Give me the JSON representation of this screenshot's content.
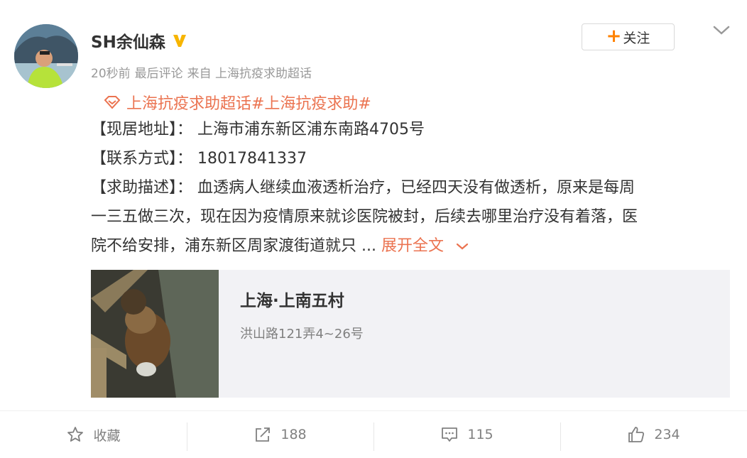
{
  "post": {
    "username": "SH余仙森",
    "meta_time": "20秒前",
    "meta_comment": "最后评论",
    "meta_source": "来自 上海抗疫求助超话",
    "follow_label": "关注",
    "topic": "上海抗疫求助超话#上海抗疫求助#",
    "line1": "【现居地址】： 上海市浦东新区浦东南路4705号",
    "line2": "【联系方式】： 18017841337",
    "line3": "【求助描述】： 血透病人继续血液透析治疗，已经四天没有做透析，原来是每周",
    "line4": "一三五做三次，现在因为疫情原来就诊医院被封，后续去哪里治疗没有着落，医",
    "line5": "院不给安排，浦东新区周家渡街道就只 ...",
    "expand_label": "展开全文"
  },
  "location_card": {
    "title": "上海·上南五村",
    "address": "洪山路121弄4~26号"
  },
  "actions": {
    "favorite_label": "收藏",
    "repost_count": "188",
    "comment_count": "115",
    "like_count": "234"
  },
  "colors": {
    "accent": "#eb7350",
    "verified": "#f7b500",
    "follow_plus": "#ff8200"
  }
}
